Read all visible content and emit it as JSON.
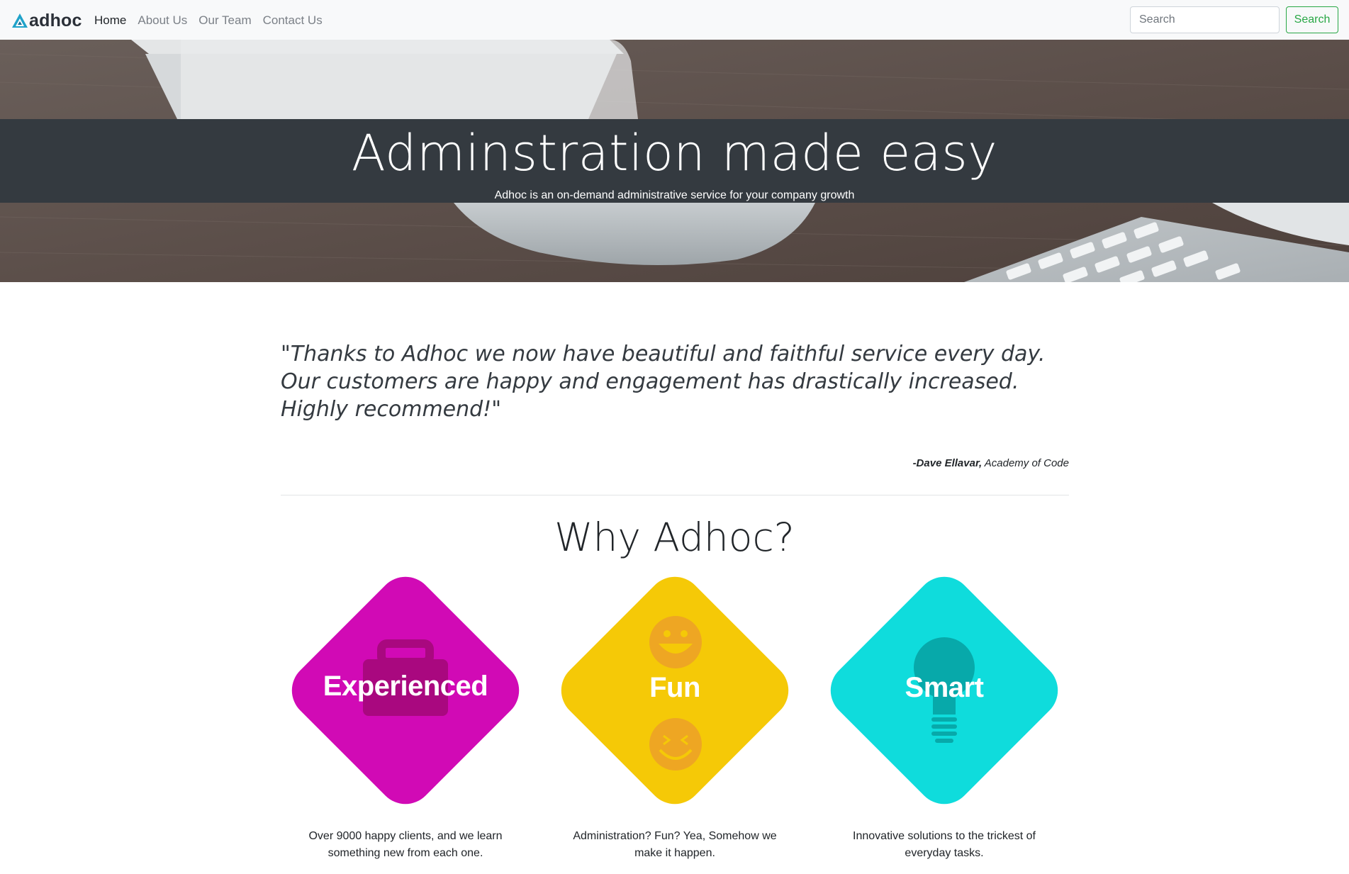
{
  "nav": {
    "brand": "adhoc",
    "links": [
      "Home",
      "About Us",
      "Our Team",
      "Contact Us"
    ],
    "active": "Home",
    "search_placeholder": "Search",
    "search_button": "Search"
  },
  "hero": {
    "title": "Adminstration made easy",
    "subtitle": "Adhoc is an on-demand administrative service for your company growth"
  },
  "testimonial": {
    "quote": "\"Thanks to Adhoc we now have beautiful and faithful service every day. Our customers are happy and engagement has drastically increased. Highly recommend!\"",
    "author": "-Dave Ellavar,",
    "organization": "Academy of Code"
  },
  "why": {
    "title": "Why Adhoc?",
    "features": [
      {
        "label": "Experienced",
        "description": "Over 9000 happy clients, and we learn something new from each one.",
        "icon": "briefcase-icon",
        "color": "#d10ab5"
      },
      {
        "label": "Fun",
        "description": "Administration? Fun? Yea, Somehow we make it happen.",
        "icon": "smiley-icon",
        "color": "#f5c907"
      },
      {
        "label": "Smart",
        "description": "Innovative solutions to the trickest of everyday tasks.",
        "icon": "lightbulb-icon",
        "color": "#0fdcdc"
      }
    ]
  },
  "colors": {
    "navbar_bg": "#f8f9fa",
    "hero_band": "#343a40",
    "success": "#28a745",
    "brand_icon": "#1fa2c9"
  }
}
